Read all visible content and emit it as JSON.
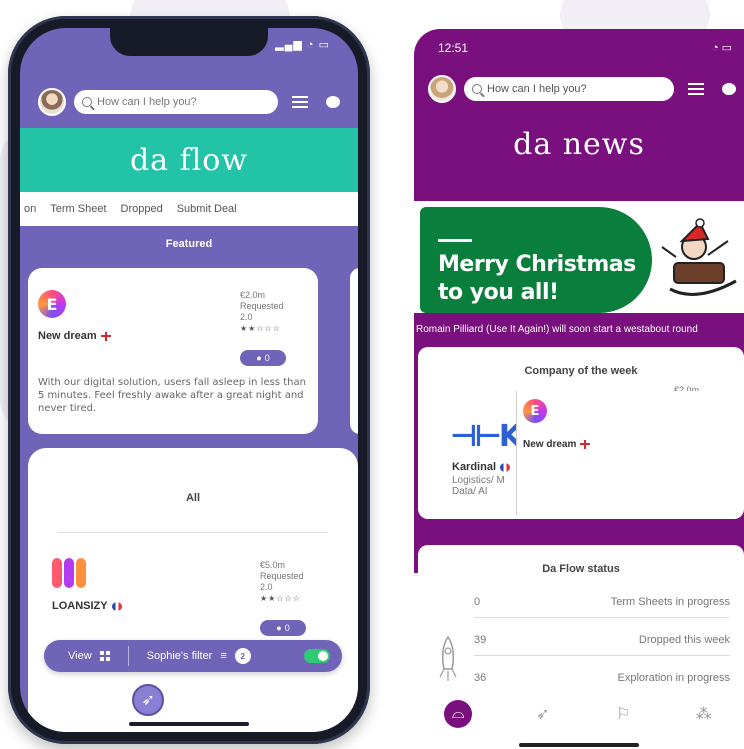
{
  "left_app": {
    "search_placeholder": "How can I help you?",
    "logo": "da flow",
    "tabs": [
      "on",
      "Term Sheet",
      "Dropped",
      "Submit Deal"
    ],
    "featured_label": "Featured",
    "featured_card": {
      "company": "New dream",
      "logo_letter": "E",
      "amount": "€2.0m",
      "requested_label": "Requested",
      "rating_value": "2.0",
      "stars": "★★☆☆☆",
      "comments": "0",
      "description": "With our digital solution, users fall asleep in less than 5 minutes. Feel freshly awake after a great night and never tired."
    },
    "all_label": "All",
    "all_card": {
      "company": "LOANSIZY",
      "amount": "€5.0m",
      "requested_label": "Requested",
      "rating_value": "2.0",
      "stars": "★★☆☆☆",
      "comments": "0"
    },
    "filter_bar": {
      "view_label": "View",
      "filter_label": "Sophie's filter",
      "filter_count": "2"
    },
    "nav_icons": [
      "ufo-icon",
      "rocket-icon",
      "flag-board-icon",
      "network-icon"
    ]
  },
  "right_app": {
    "time": "12:51",
    "search_placeholder": "How can I help you?",
    "logo": "da news",
    "banner_text_line1": "Merry Christmas",
    "banner_text_line2": "to you all!",
    "ticker": "Romain Pilliard (Use It Again!) will soon start a westabout round",
    "company_of_week_title": "Company of the week",
    "company_of_week_amount": "€2.0m",
    "kardinal": {
      "name": "Kardinal",
      "sector_line1": "Logistics/ M",
      "sector_line2": "Data/ AI"
    },
    "overlay_company": "New dream",
    "overlay_logo_letter": "E",
    "status_title": "Da Flow status",
    "status_rows": [
      {
        "num": "0",
        "label": "Term Sheets in progress"
      },
      {
        "num": "39",
        "label": "Dropped this week"
      },
      {
        "num": "36",
        "label": "Exploration in progress"
      }
    ]
  },
  "colors": {
    "flow_purple": "#6f64b7",
    "flow_teal": "#22c3a6",
    "news_purple": "#7a0f7e",
    "xmas_green": "#0a7e3c"
  }
}
